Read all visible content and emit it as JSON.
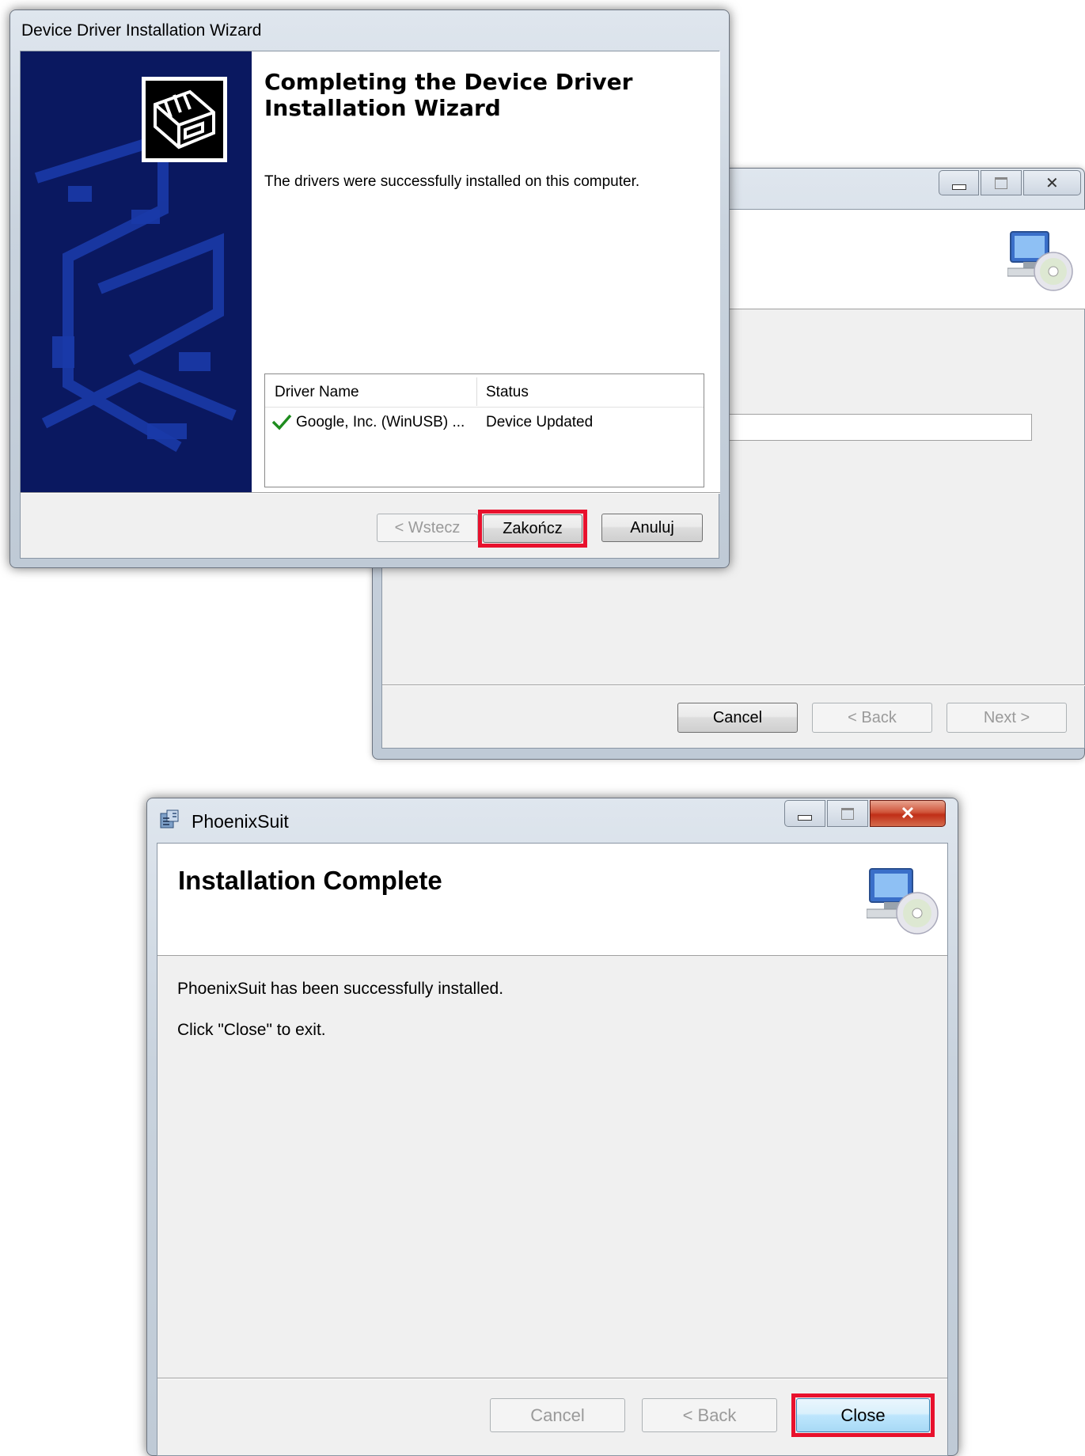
{
  "back_window": {
    "button_cancel": "Cancel",
    "button_back": "< Back",
    "button_next": "Next >"
  },
  "driver_wizard": {
    "title": "Device Driver Installation Wizard",
    "heading_line1": "Completing the Device Driver",
    "heading_line2": "Installation Wizard",
    "message": "The drivers were successfully installed on this computer.",
    "table": {
      "columns": [
        "Driver Name",
        "Status"
      ],
      "rows": [
        {
          "driver_name": "Google, Inc. (WinUSB) ...",
          "status": "Device Updated"
        }
      ]
    },
    "button_back": "< Wstecz",
    "button_finish": "Zakończ",
    "button_cancel": "Anuluj"
  },
  "phoenix_window": {
    "title": "PhoenixSuit",
    "heading": "Installation Complete",
    "message1": "PhoenixSuit has been successfully installed.",
    "message2": "Click \"Close\" to exit.",
    "button_cancel": "Cancel",
    "button_back": "< Back",
    "button_close": "Close"
  },
  "highlight_color": "#e8112d",
  "success_check_color": "#1e8c1e",
  "icons": {
    "wizard_badge": "hardware-card-icon",
    "setup_computer": "computer-cd-icon",
    "phoenix_app": "installer-app-icon",
    "check": "check-icon"
  }
}
